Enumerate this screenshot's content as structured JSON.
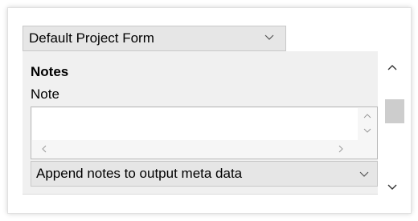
{
  "form_selector": {
    "value": "Default Project Form"
  },
  "notes_section": {
    "title": "Notes",
    "note_label": "Note",
    "note_value": ""
  },
  "append_selector": {
    "value": "Append notes to output meta data"
  },
  "colors": {
    "panel_bg": "#ffffff",
    "content_bg": "#f0f0f0",
    "select_bg": "#e6e6e6",
    "scroll_thumb": "#cdcdcd"
  },
  "icons": {
    "select_arrow": "chevron-down-icon",
    "scroll_up": "chevron-up-icon",
    "scroll_down": "chevron-down-icon",
    "scroll_left": "chevron-left-icon",
    "scroll_right": "chevron-right-icon"
  }
}
